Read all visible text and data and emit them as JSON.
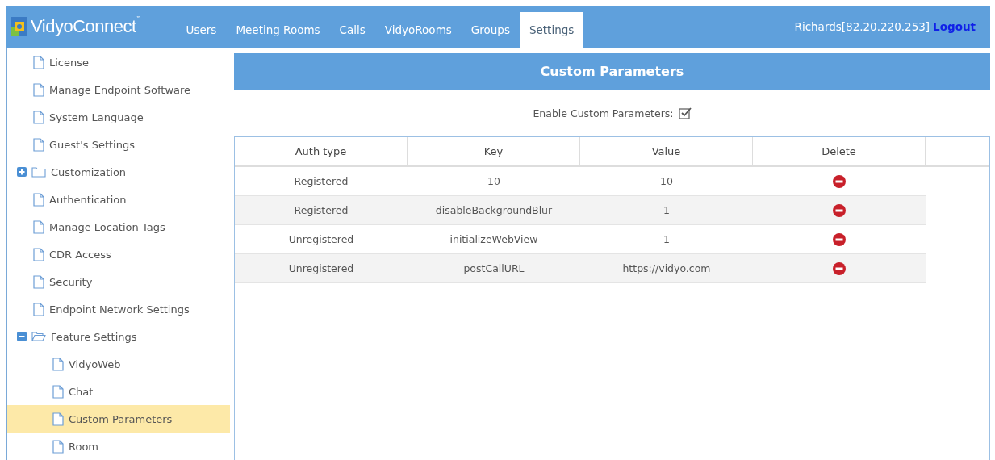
{
  "header": {
    "logo": "VidyoConnect",
    "logo_mark": "™",
    "user": "Richards[82.20.220.253]",
    "logout": "Logout"
  },
  "tabs": [
    {
      "label": "Users",
      "selected": false
    },
    {
      "label": "Meeting Rooms",
      "selected": false
    },
    {
      "label": "Calls",
      "selected": false
    },
    {
      "label": "VidyoRooms",
      "selected": false
    },
    {
      "label": "Groups",
      "selected": false
    },
    {
      "label": "Settings",
      "selected": true
    }
  ],
  "sidebar": {
    "items": [
      {
        "label": "License",
        "selected": false
      },
      {
        "label": "Manage Endpoint Software",
        "selected": false
      },
      {
        "label": "System Language",
        "selected": false
      },
      {
        "label": "Guest's Settings",
        "selected": false
      },
      {
        "label": "Customization",
        "selected": false,
        "expanded": false
      },
      {
        "label": "Authentication",
        "selected": false
      },
      {
        "label": "Manage Location Tags",
        "selected": false
      },
      {
        "label": "CDR Access",
        "selected": false
      },
      {
        "label": "Security",
        "selected": false
      },
      {
        "label": "Endpoint Network Settings",
        "selected": false
      },
      {
        "label": "Feature Settings",
        "selected": false,
        "expanded": true,
        "children": [
          {
            "label": "VidyoWeb",
            "selected": false
          },
          {
            "label": "Chat",
            "selected": false
          },
          {
            "label": "Custom Parameters",
            "selected": true
          },
          {
            "label": "Room",
            "selected": false
          }
        ]
      }
    ]
  },
  "panel": {
    "title": "Custom Parameters",
    "enable_label": "Enable Custom Parameters:",
    "enable_checked": true
  },
  "table": {
    "columns": [
      "Auth type",
      "Key",
      "Value",
      "Delete"
    ],
    "rows": [
      [
        "Registered",
        "10",
        "10"
      ],
      [
        "Registered",
        "disableBackgroundBlur",
        "1"
      ],
      [
        "Unregistered",
        "initializeWebView",
        "1"
      ],
      [
        "Unregistered",
        "postCallURL",
        "https://vidyo.com"
      ]
    ]
  }
}
